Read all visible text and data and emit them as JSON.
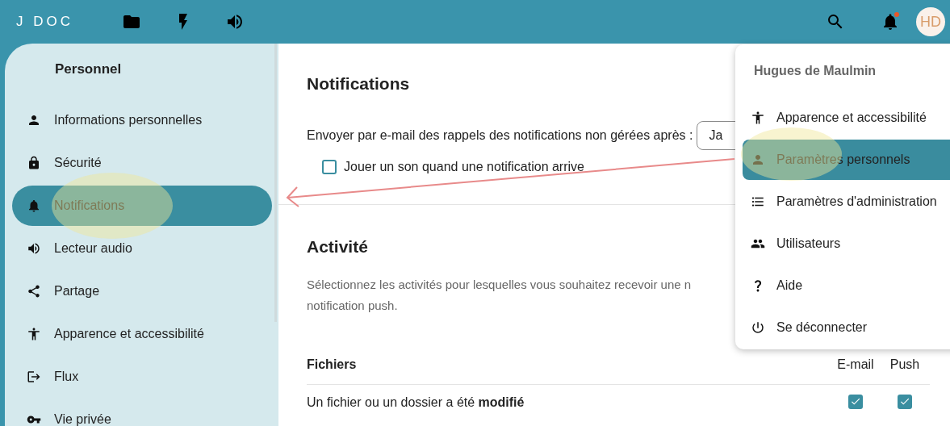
{
  "header": {
    "logo": "J DOC",
    "avatar": "HD",
    "unread_notifications": true
  },
  "sidebar": {
    "title": "Personnel",
    "items": [
      {
        "kind": "person",
        "label": "Informations personnelles",
        "selected": false
      },
      {
        "kind": "lock",
        "label": "Sécurité",
        "selected": false
      },
      {
        "kind": "bell",
        "label": "Notifications",
        "selected": true
      },
      {
        "kind": "speaker",
        "label": "Lecteur audio",
        "selected": false
      },
      {
        "kind": "share",
        "label": "Partage",
        "selected": false
      },
      {
        "kind": "accessibility",
        "label": "Apparence et accessibilité",
        "selected": false
      },
      {
        "kind": "flux",
        "label": "Flux",
        "selected": false
      },
      {
        "kind": "key",
        "label": "Vie privée",
        "selected": false
      }
    ]
  },
  "notifications": {
    "title": "Notifications",
    "reminder_label": "Envoyer par e-mail des rappels des notifications non gérées après :",
    "reminder_value": "Ja",
    "sound": {
      "label": "Jouer un son quand une notification arrive",
      "checked": false
    }
  },
  "activity": {
    "title": "Activité",
    "description_lines": [
      "Sélectionnez les activités pour lesquelles vous souhaitez recevoir une n",
      "notification push."
    ],
    "table": {
      "columns": [
        "Fichiers",
        "E-mail",
        "Push"
      ],
      "rows": [
        {
          "label": "Un fichier ou un dossier a été **modifié**",
          "email": true,
          "push": true
        }
      ]
    }
  },
  "user_menu": {
    "name": "Hugues de Maulmin",
    "items": [
      {
        "kind": "accessibility",
        "label": "Apparence et accessibilité",
        "selected": false
      },
      {
        "kind": "person",
        "label": "Paramètres personnels",
        "selected": true
      },
      {
        "kind": "list",
        "label": "Paramètres d'administration",
        "selected": false
      },
      {
        "kind": "group",
        "label": "Utilisateurs",
        "selected": false
      },
      {
        "kind": "question",
        "label": "Aide",
        "selected": false
      },
      {
        "kind": "power",
        "label": "Se déconnecter",
        "selected": false
      }
    ]
  }
}
